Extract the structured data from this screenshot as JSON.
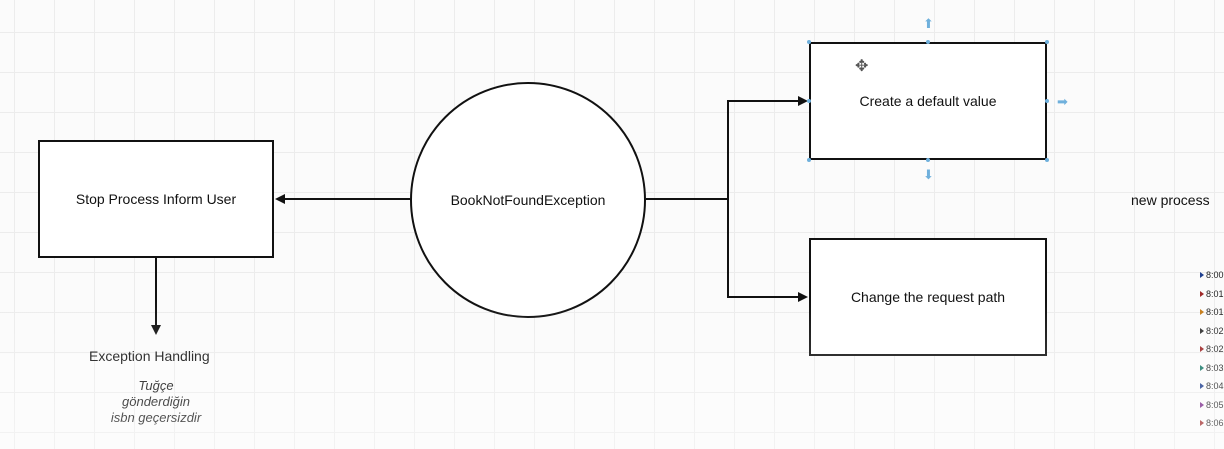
{
  "nodes": {
    "exception": "BookNotFoundException",
    "stop": "Stop Process Inform User",
    "default_value": "Create a default value",
    "change_path": "Change the request path"
  },
  "labels": {
    "exception_handling": "Exception Handling",
    "new_process": "new process"
  },
  "note": {
    "lines": [
      "Tuğçe",
      "gönderdiğin",
      "isbn geçersizdir"
    ]
  },
  "side_list": {
    "items": [
      {
        "text": "8:00",
        "color": "#1f3f8f"
      },
      {
        "text": "8:01",
        "color": "#a02a2a"
      },
      {
        "text": "8:01",
        "color": "#c77d1a"
      },
      {
        "text": "8:02",
        "color": "#333333"
      },
      {
        "text": "8:02",
        "color": "#a02a2a"
      },
      {
        "text": "8:03",
        "color": "#1a7a6a"
      },
      {
        "text": "8:04",
        "color": "#1f3f8f"
      },
      {
        "text": "8:05",
        "color": "#7a2a8a"
      },
      {
        "text": "8:06",
        "color": "#a02a2a"
      }
    ]
  },
  "colors": {
    "stroke": "#111111",
    "selection_handle": "#6fb0dc"
  }
}
